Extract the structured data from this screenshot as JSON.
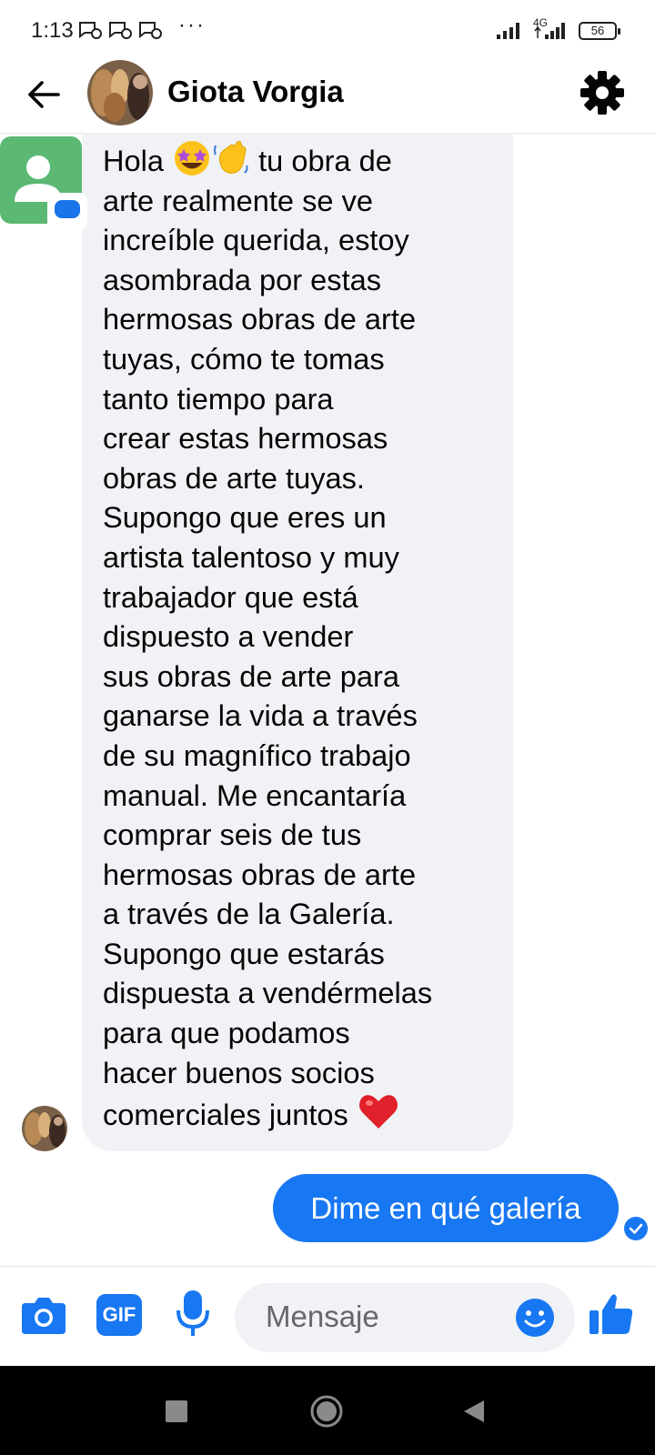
{
  "status_bar": {
    "time": "1:13",
    "overflow_dots": "···",
    "network_label": "4G",
    "battery": "56"
  },
  "header": {
    "contact_name": "Giota Vorgia",
    "back_icon": "arrow-left-icon",
    "settings_icon": "gear-icon"
  },
  "conversation": {
    "incoming": {
      "greeting": "Hola ",
      "emojis": [
        "star-struck-emoji",
        "waving-hand-emoji"
      ],
      "body": " tu obra de\narte realmente se ve\nincreíble querida, estoy\nasombrada por estas\nhermosas obras de arte\ntuyas, cómo te tomas\ntanto tiempo para\ncrear estas hermosas\nobras de arte tuyas.\nSupongo que eres un\nartista talentoso y muy\ntrabajador que está\ndispuesto a vender\nsus obras de arte para\nganarse la vida a través\nde su magnífico trabajo\nmanual. Me encantaría\ncomprar seis de tus\nhermosas obras de arte\na través de la Galería.\nSupongo que estarás\ndispuesta a vendérmelas\npara que podamos\nhacer buenos socios\ncomerciales juntos ",
      "end_emoji": "red-heart-emoji"
    },
    "outgoing": {
      "text": "Dime en qué galería",
      "status_icon": "check-circle-icon"
    }
  },
  "composer": {
    "placeholder": "Mensaje",
    "gif_label": "GIF",
    "icons": [
      "camera-icon",
      "gif-icon",
      "microphone-icon",
      "emoji-icon",
      "thumbs-up-icon"
    ]
  },
  "colors": {
    "accent": "#1877f2",
    "incoming_bubble": "#f0f2f5",
    "text": "#050505",
    "placeholder": "#65676b"
  }
}
